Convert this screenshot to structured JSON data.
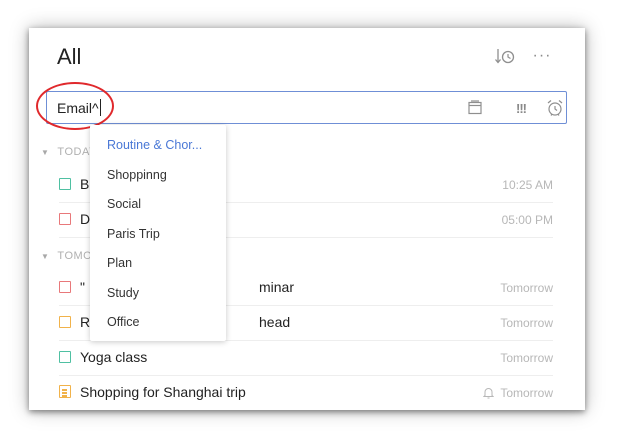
{
  "header": {
    "title": "All",
    "sort_icon": "sort-by-time-icon",
    "more_label": "···"
  },
  "input": {
    "value": "Email^",
    "icons": [
      "list-icon",
      "priority-icon",
      "alarm-icon"
    ],
    "prio_label": "!!!"
  },
  "sections": {
    "today": {
      "label": "TODAY"
    },
    "tomorrow": {
      "label": "TOMORROW"
    }
  },
  "tasks": [
    {
      "title": "B",
      "date": "10:25 AM",
      "check_color": "#4fc0a2"
    },
    {
      "title": "D",
      "date": "05:00 PM",
      "check_color": "#e8787a"
    },
    {
      "title": "\"",
      "title_tail": "minar",
      "date": "Tomorrow",
      "check_color": "#e8787a"
    },
    {
      "title": "R",
      "title_tail": "head",
      "date": "Tomorrow",
      "check_color": "#f1b24a"
    },
    {
      "title": "Yoga class",
      "date": "Tomorrow",
      "check_color": "#4fc0a2"
    },
    {
      "title": "Shopping for Shanghai trip",
      "date": "Tomorrow",
      "check_color": "#f1b24a",
      "has_reminder": true
    }
  ],
  "dropdown": {
    "items": [
      "Routine & Chor...",
      "Shoppinng",
      "Social",
      "Paris Trip",
      "Plan",
      "Study",
      "Office"
    ],
    "selected_index": 0,
    "accent": "#4a78d6"
  }
}
